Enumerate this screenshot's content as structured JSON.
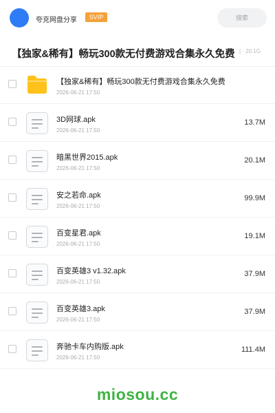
{
  "header": {
    "brand": "夸克网盘分享",
    "badge": "SVIP",
    "search_placeholder": "搜索"
  },
  "folder": {
    "title": "【独家&稀有】畅玩300款无付费游戏合集永久免费",
    "meta": "| · 20.1G"
  },
  "items": [
    {
      "name": "【独家&稀有】畅玩300款无付费游戏合集永久免费",
      "time": "2026-06-21 17:50",
      "size": "",
      "type": "folder",
      "icon": "folder-icon"
    },
    {
      "name": "3D网球.apk",
      "time": "2026-06-21 17:50",
      "size": "13.7M",
      "type": "file",
      "icon": "file-icon"
    },
    {
      "name": "暗黑世界2015.apk",
      "time": "2026-06-21 17:50",
      "size": "20.1M",
      "type": "file",
      "icon": "file-icon"
    },
    {
      "name": "安之若命.apk",
      "time": "2026-06-21 17:50",
      "size": "99.9M",
      "type": "file",
      "icon": "file-icon"
    },
    {
      "name": "百变星君.apk",
      "time": "2026-06-21 17:50",
      "size": "19.1M",
      "type": "file",
      "icon": "file-icon"
    },
    {
      "name": "百变英雄3 v1.32.apk",
      "time": "2026-06-21 17:50",
      "size": "37.9M",
      "type": "file",
      "icon": "file-icon"
    },
    {
      "name": "百变英雄3.apk",
      "time": "2026-06-21 17:50",
      "size": "37.9M",
      "type": "file",
      "icon": "file-icon"
    },
    {
      "name": "奔驰卡车内购版.apk",
      "time": "2026-06-21 17:50",
      "size": "111.4M",
      "type": "file",
      "icon": "file-icon"
    }
  ],
  "watermark": "miosou.cc",
  "colors": {
    "avatar": "#2f7cf6",
    "badge": "#f4a13a",
    "folder": "#ffc21a",
    "watermark": "#3db343"
  }
}
